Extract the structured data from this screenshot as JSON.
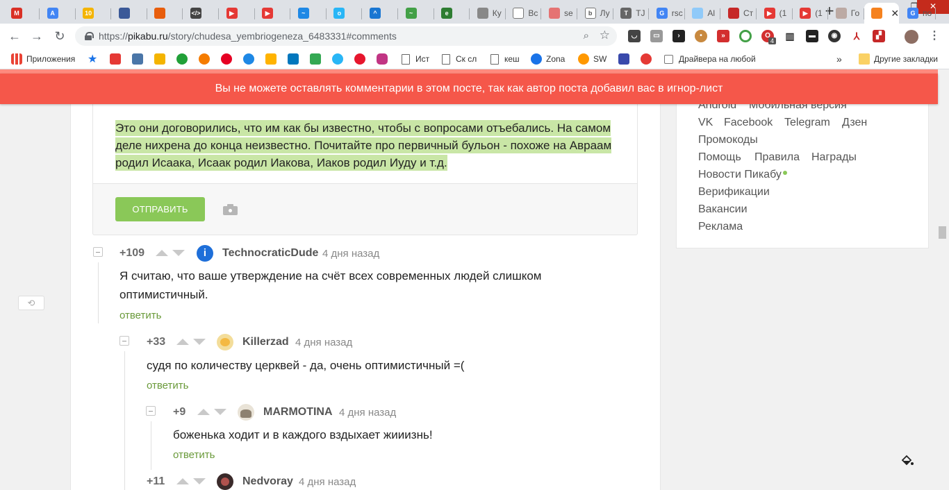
{
  "browser": {
    "tabs": [
      {
        "label": "",
        "color": "#d93025",
        "glyph": "M"
      },
      {
        "label": "",
        "color": "#4285f4",
        "glyph": "A"
      },
      {
        "label": "",
        "color": "#f4b400",
        "glyph": "10"
      },
      {
        "label": "",
        "color": "#3b5998",
        "glyph": ""
      },
      {
        "label": "",
        "color": "#e85d0c",
        "glyph": ""
      },
      {
        "label": "",
        "color": "#444444",
        "glyph": "</>"
      },
      {
        "label": "",
        "color": "#e53935",
        "glyph": "▶"
      },
      {
        "label": "",
        "color": "#e53935",
        "glyph": "▶"
      },
      {
        "label": "",
        "color": "#1e88e5",
        "glyph": "~"
      },
      {
        "label": "",
        "color": "#29b6f6",
        "glyph": "o"
      },
      {
        "label": "",
        "color": "#1976d2",
        "glyph": "^"
      },
      {
        "label": "",
        "color": "#43a047",
        "glyph": "~"
      },
      {
        "label": "",
        "color": "#2e7d32",
        "glyph": "e"
      },
      {
        "label": "Ку",
        "color": "#888888",
        "glyph": ""
      },
      {
        "label": "Вс",
        "color": "#ffffff",
        "glyph": ""
      },
      {
        "label": "se",
        "color": "#e57373",
        "glyph": ""
      },
      {
        "label": "Лу",
        "color": "#ffffff",
        "glyph": "b"
      },
      {
        "label": "TJ",
        "color": "#666666",
        "glyph": "T"
      },
      {
        "label": "rsc",
        "color": "#4285f4",
        "glyph": "G"
      },
      {
        "label": "Al",
        "color": "#90caf9",
        "glyph": ""
      },
      {
        "label": "Ст",
        "color": "#c62828",
        "glyph": ""
      },
      {
        "label": "(1",
        "color": "#e53935",
        "glyph": "▶"
      },
      {
        "label": "(1",
        "color": "#e53935",
        "glyph": "▶"
      },
      {
        "label": "Го",
        "color": "#bcaaa4",
        "glyph": ""
      },
      {
        "label": "",
        "color": "#f5821f",
        "glyph": ""
      },
      {
        "label": "по",
        "color": "#4285f4",
        "glyph": "G"
      }
    ],
    "active_tab_close": "✕",
    "new_tab": "+",
    "url_main": "pikabu.ru",
    "url_prefix": "https://",
    "url_path": "/story/chudesa_yembriogeneza_6483331#comments",
    "extension_badge": "4"
  },
  "bookmarks": {
    "apps_label": "Приложения",
    "items": [
      {
        "label": "Ист",
        "type": "doc"
      },
      {
        "label": "Ск сл",
        "type": "doc"
      },
      {
        "label": "кеш",
        "type": "doc"
      },
      {
        "label": "Zona",
        "type": "icon"
      },
      {
        "label": "SW",
        "type": "icon"
      },
      {
        "label": "Драйвера на любой",
        "type": "check"
      }
    ],
    "more": "»",
    "other_label": "Другие закладки"
  },
  "banner": {
    "text": "Вы не можете оставлять комментарии в этом посте, так как автор поста добавил вас в игнор-лист"
  },
  "sidebar": {
    "row1": [
      "Android",
      "Мобильная версия"
    ],
    "row2": [
      "VK",
      "Facebook",
      "Telegram",
      "Дзен"
    ],
    "promo": "Промокоды",
    "row4": [
      "Помощь",
      "Правила",
      "Награды"
    ],
    "news": "Новости Пикабу",
    "verification": "Верификации",
    "vacancies": "Вакансии",
    "ads": "Реклама"
  },
  "editor": {
    "text": "Это они договорились, что им как бы известно, чтобы с вопросами отъебались. На самом деле нихрена до конца неизвестно. Почитайте про первичный бульон - похоже на Авраам родил Исаака, Исаак родил Иакова, Иаков родил Иуду и т.д.",
    "send_label": "ОТПРАВИТЬ"
  },
  "comments": [
    {
      "rating": "+109",
      "user": "TechnocraticDude",
      "time": "4 дня назад",
      "text": "Я считаю, что ваше утверждение на счёт всех современных людей слишком оптимистичный.",
      "reply": "ответить"
    },
    {
      "rating": "+33",
      "user": "Killerzad",
      "time": "4 дня назад",
      "text": "судя по количеству церквей - да, очень оптимистичный =(",
      "reply": "ответить"
    },
    {
      "rating": "+9",
      "user": "MARMOTINA",
      "time": "4 дня назад",
      "text": "боженька ходит и в каждого вздыхает жииизнь!",
      "reply": "ответить"
    },
    {
      "rating": "+11",
      "user": "Nedvoray",
      "time": "4 дня назад",
      "text": "",
      "reply": ""
    }
  ]
}
